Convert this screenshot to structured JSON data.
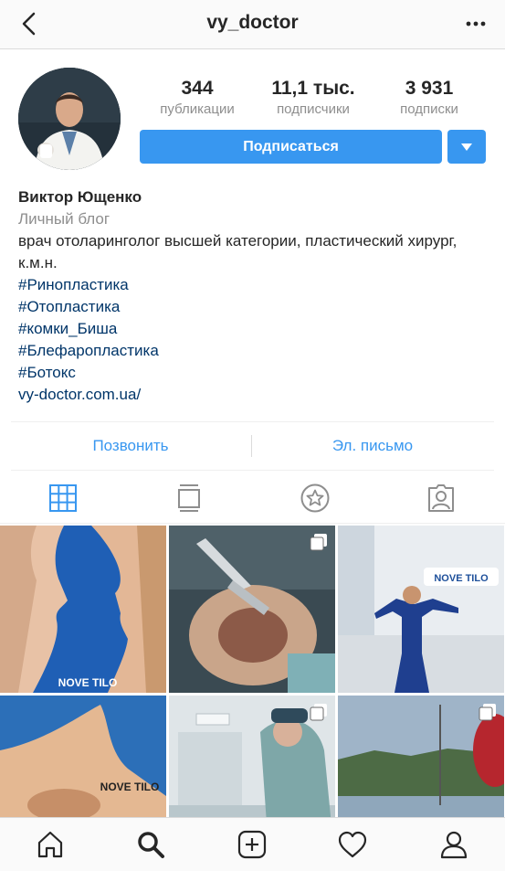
{
  "header": {
    "username": "vy_doctor"
  },
  "profile": {
    "stats": [
      {
        "number": "344",
        "label": "публикации"
      },
      {
        "number": "11,1 тыс.",
        "label": "подписчики"
      },
      {
        "number": "3 931",
        "label": "подписки"
      }
    ],
    "follow_label": "Подписаться"
  },
  "bio": {
    "name": "Виктор Ющенко",
    "category": "Личный блог",
    "text": "врач отоларинголог высшей категории, пластический хирург, к.м.н.",
    "hashtags": [
      "#Ринопластика",
      "#Отопластика",
      "#комки_Биша",
      "#Блефаропластика",
      "#Ботокс"
    ],
    "website": "vy-doctor.com.ua/"
  },
  "contact": {
    "call_label": "Позвонить",
    "email_label": "Эл. письмо"
  },
  "tabs": [
    "grid-icon",
    "feed-icon",
    "saved-icon",
    "tagged-icon"
  ],
  "grid": {
    "watermarks": [
      "NOVE TILO",
      "NOVE TILO"
    ],
    "sign_text": "NOVE TILO"
  },
  "bottom_nav": [
    "home-icon",
    "search-icon",
    "add-icon",
    "heart-icon",
    "profile-icon"
  ],
  "colors": {
    "accent": "#3897f0",
    "link": "#003569",
    "secondary_text": "#8e8e8e"
  }
}
